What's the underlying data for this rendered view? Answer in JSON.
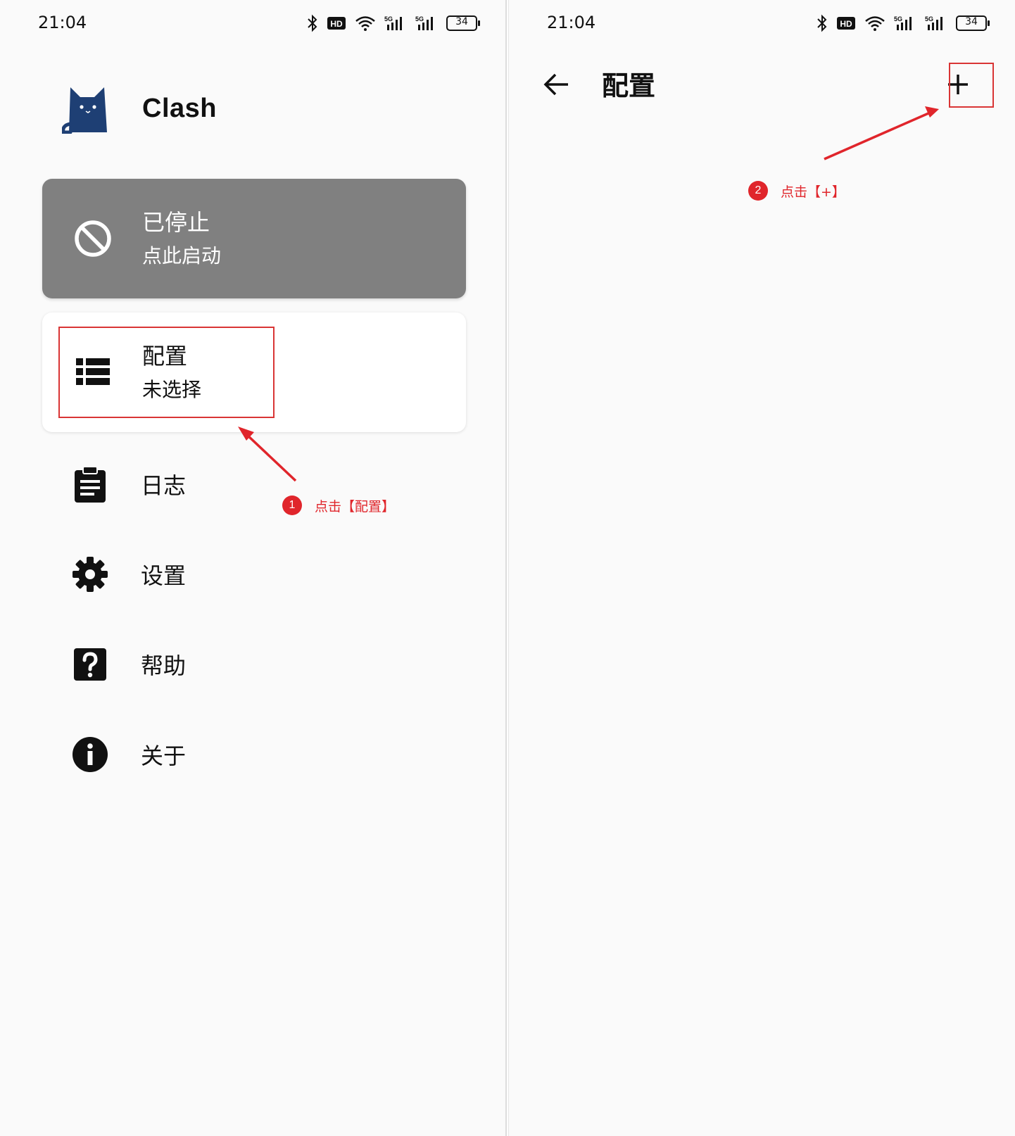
{
  "left": {
    "status_time": "21:04",
    "battery": "34",
    "app_title": "Clash",
    "status_card": {
      "title": "已停止",
      "subtitle": "点此启动"
    },
    "profile_card": {
      "title": "配置",
      "subtitle": "未选择"
    },
    "menu": [
      {
        "label": "日志",
        "icon": "clipboard-icon"
      },
      {
        "label": "设置",
        "icon": "gear-icon"
      },
      {
        "label": "帮助",
        "icon": "help-icon"
      },
      {
        "label": "关于",
        "icon": "info-icon"
      }
    ],
    "annotation": {
      "number": "1",
      "text": "点击【配置】"
    }
  },
  "right": {
    "status_time": "21:04",
    "battery": "34",
    "page_title": "配置",
    "add_label": "+",
    "annotation": {
      "number": "2",
      "text": "点击【+】"
    }
  },
  "colors": {
    "accent_red": "#e0252b",
    "card_grey": "#808080",
    "logo_blue": "#1e3f74"
  }
}
